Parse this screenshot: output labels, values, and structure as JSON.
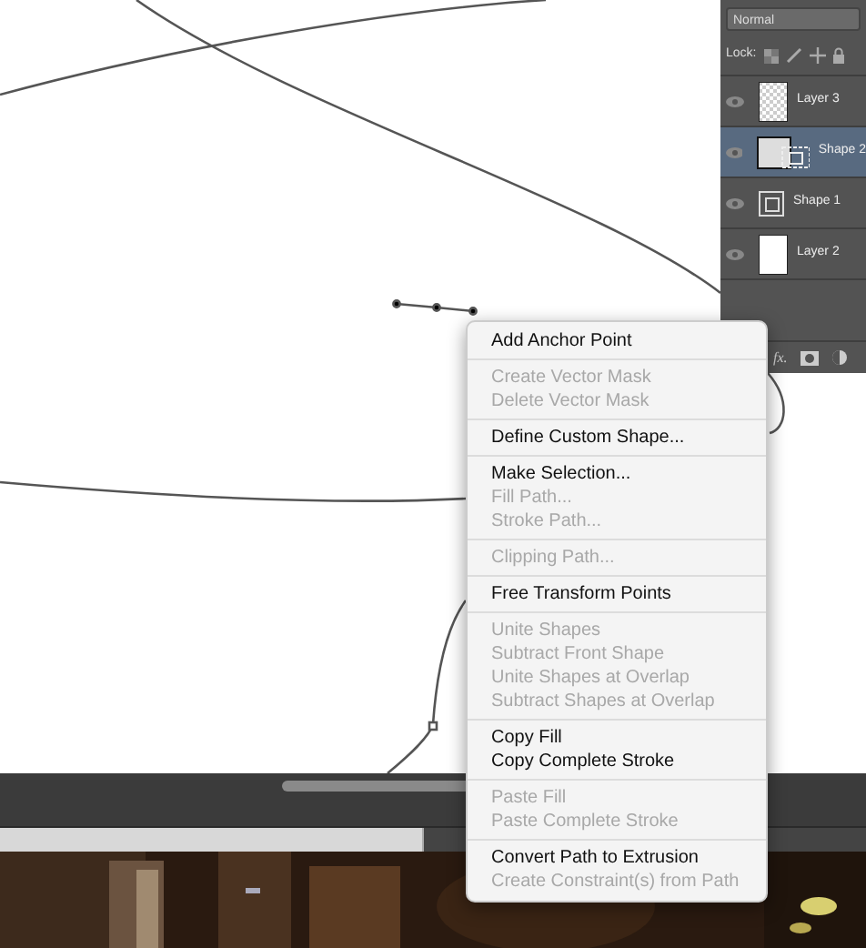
{
  "layers_panel": {
    "blend_mode": "Normal",
    "lock_label": "Lock:",
    "layers": [
      {
        "name": "Layer 3",
        "kind": "transparent",
        "selected": false
      },
      {
        "name": "Shape 2",
        "kind": "shape-fill",
        "selected": true
      },
      {
        "name": "Shape 1",
        "kind": "shape",
        "selected": false
      },
      {
        "name": "Layer 2",
        "kind": "white",
        "selected": false
      }
    ],
    "footer_label": "fx."
  },
  "context_menu": {
    "groups": [
      [
        {
          "label": "Add Anchor Point",
          "disabled": false
        }
      ],
      [
        {
          "label": "Create Vector Mask",
          "disabled": true
        },
        {
          "label": "Delete Vector Mask",
          "disabled": true
        }
      ],
      [
        {
          "label": "Define Custom Shape...",
          "disabled": false
        }
      ],
      [
        {
          "label": "Make Selection...",
          "disabled": false
        },
        {
          "label": "Fill Path...",
          "disabled": true
        },
        {
          "label": "Stroke Path...",
          "disabled": true
        }
      ],
      [
        {
          "label": "Clipping Path...",
          "disabled": true
        }
      ],
      [
        {
          "label": "Free Transform Points",
          "disabled": false
        }
      ],
      [
        {
          "label": "Unite Shapes",
          "disabled": true
        },
        {
          "label": "Subtract Front Shape",
          "disabled": true
        },
        {
          "label": "Unite Shapes at Overlap",
          "disabled": true
        },
        {
          "label": "Subtract Shapes at Overlap",
          "disabled": true
        }
      ],
      [
        {
          "label": "Copy Fill",
          "disabled": false
        },
        {
          "label": "Copy Complete Stroke",
          "disabled": false
        }
      ],
      [
        {
          "label": "Paste Fill",
          "disabled": true
        },
        {
          "label": "Paste Complete Stroke",
          "disabled": true
        }
      ],
      [
        {
          "label": "Convert Path to Extrusion",
          "disabled": false
        },
        {
          "label": "Create Constraint(s) from Path",
          "disabled": true
        }
      ]
    ]
  }
}
